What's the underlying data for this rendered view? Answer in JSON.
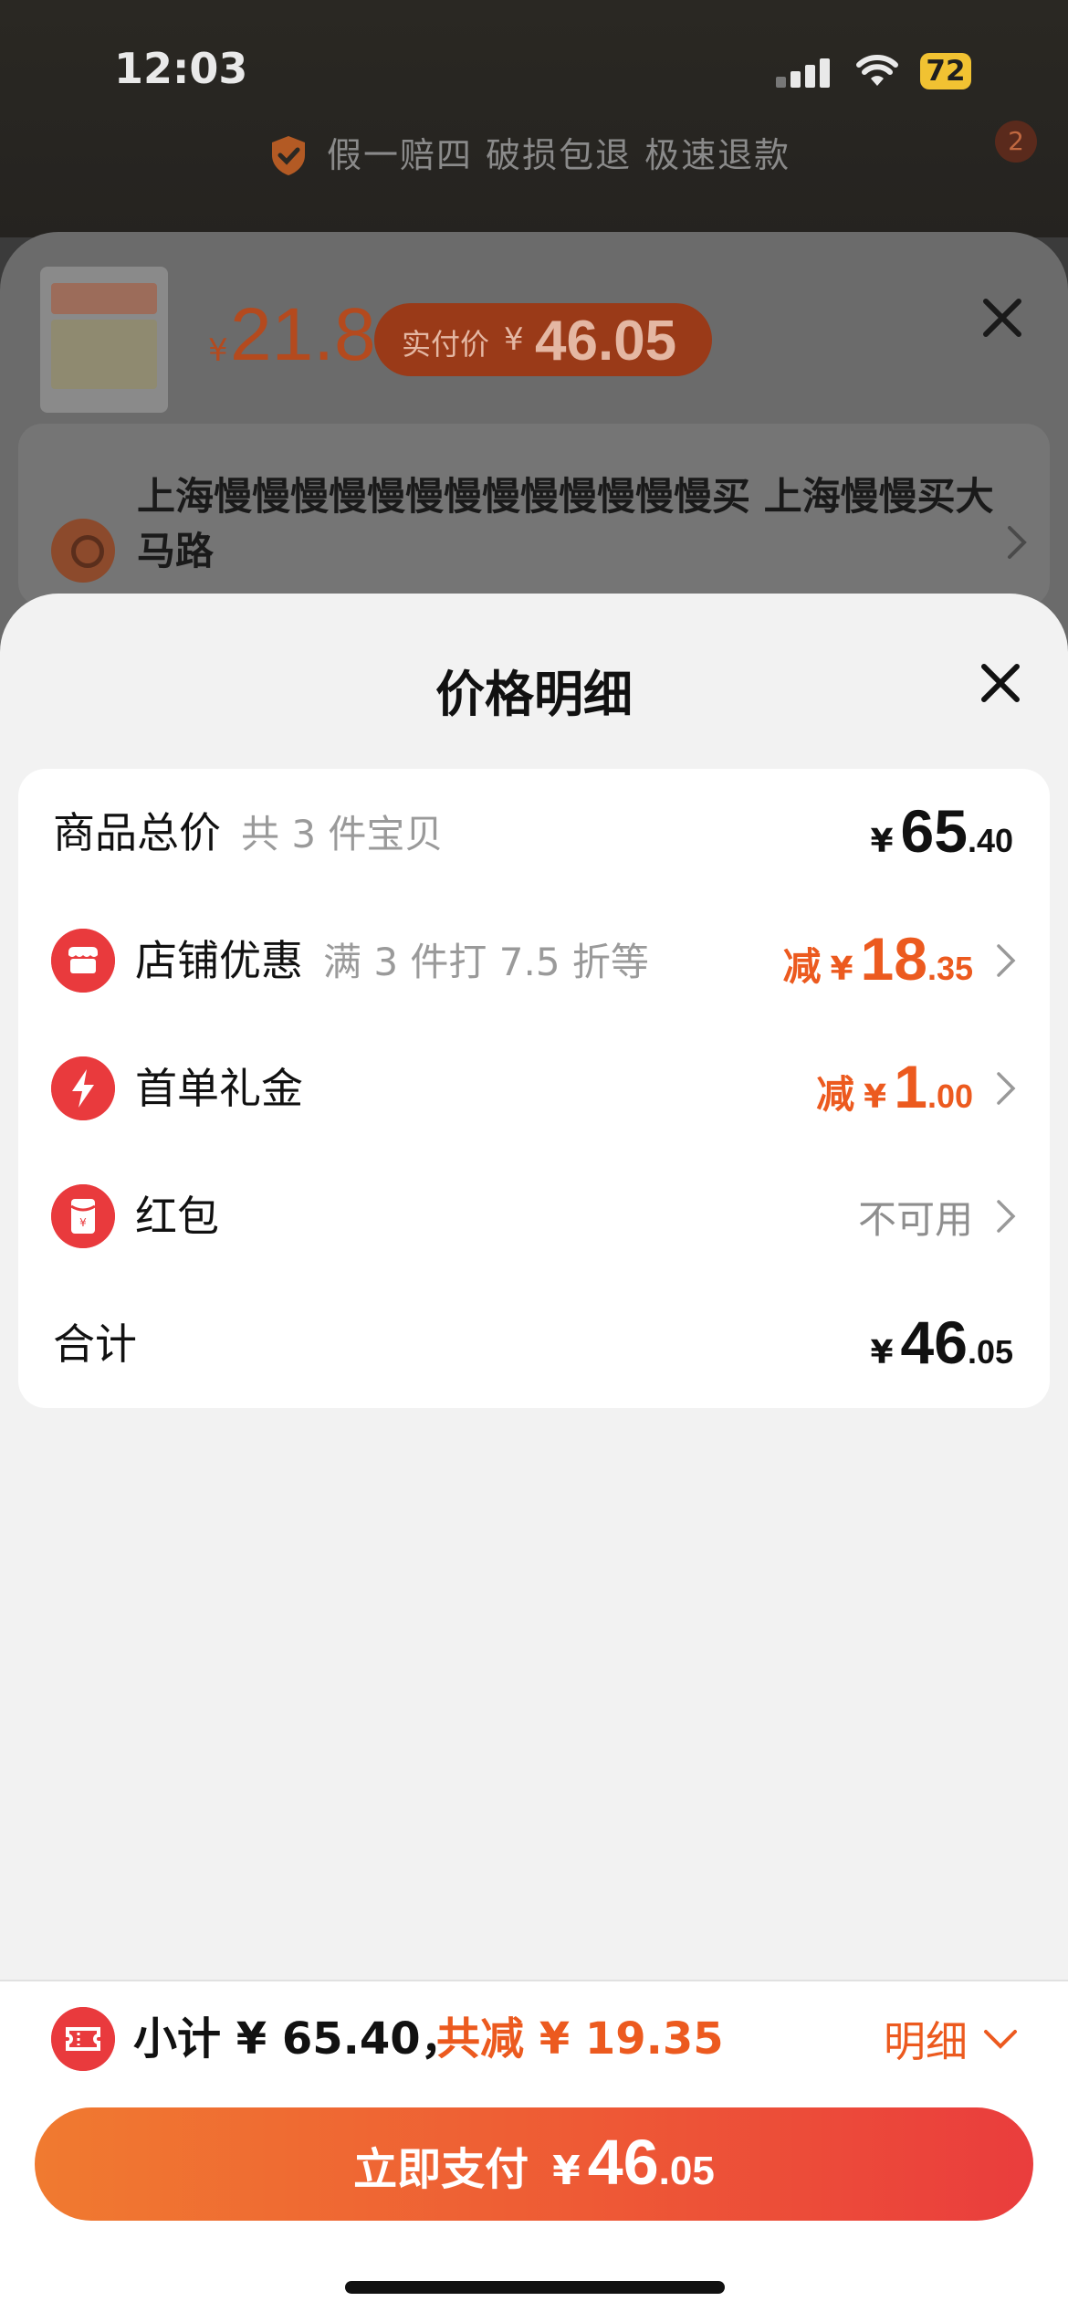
{
  "status_bar": {
    "time": "12:03",
    "battery": "72"
  },
  "trust_banner": {
    "text": "假一赔四 破损包退 极速退款"
  },
  "background_badge": "2",
  "order_sheet": {
    "price_yen": "¥",
    "price": "21.8",
    "paid_label": "实付价",
    "paid_yen": "¥",
    "paid_value": "46.05",
    "address": "上海慢慢慢慢慢慢慢慢慢慢慢慢慢买 上海慢慢买大马路"
  },
  "price_detail": {
    "title": "价格明细",
    "rows": [
      {
        "label": "商品总价",
        "sub": "共 3 件宝贝",
        "prefix": "",
        "yen": "¥",
        "int": "65",
        "dec": ".40"
      },
      {
        "label": "店铺优惠",
        "sub": "满 3 件打 7.5 折等",
        "prefix": "减",
        "yen": "¥",
        "int": "18",
        "dec": ".35",
        "icon": "shop-icon"
      },
      {
        "label": "首单礼金",
        "sub": "",
        "prefix": "减",
        "yen": "¥",
        "int": "1",
        "dec": ".00",
        "icon": "lightning-icon"
      },
      {
        "label": "红包",
        "sub": "",
        "status": "不可用",
        "icon": "red-packet-icon"
      },
      {
        "label": "合计",
        "sub": "",
        "prefix": "",
        "yen": "¥",
        "int": "46",
        "dec": ".05"
      }
    ]
  },
  "bottom_bar": {
    "subtotal": "小计 ¥ 65.40，",
    "saved": "共减 ¥ 19.35",
    "detail_toggle": "明细",
    "pay_label": "立即支付",
    "pay_yen": "¥",
    "pay_int": "46",
    "pay_dec": ".05"
  },
  "colors": {
    "accent": "#ec5a1f",
    "icon_red": "#e93a3d",
    "pay_gradient_start": "#f07a30",
    "pay_gradient_end": "#ea3d3d",
    "panel_bg": "#f2f2f2"
  }
}
